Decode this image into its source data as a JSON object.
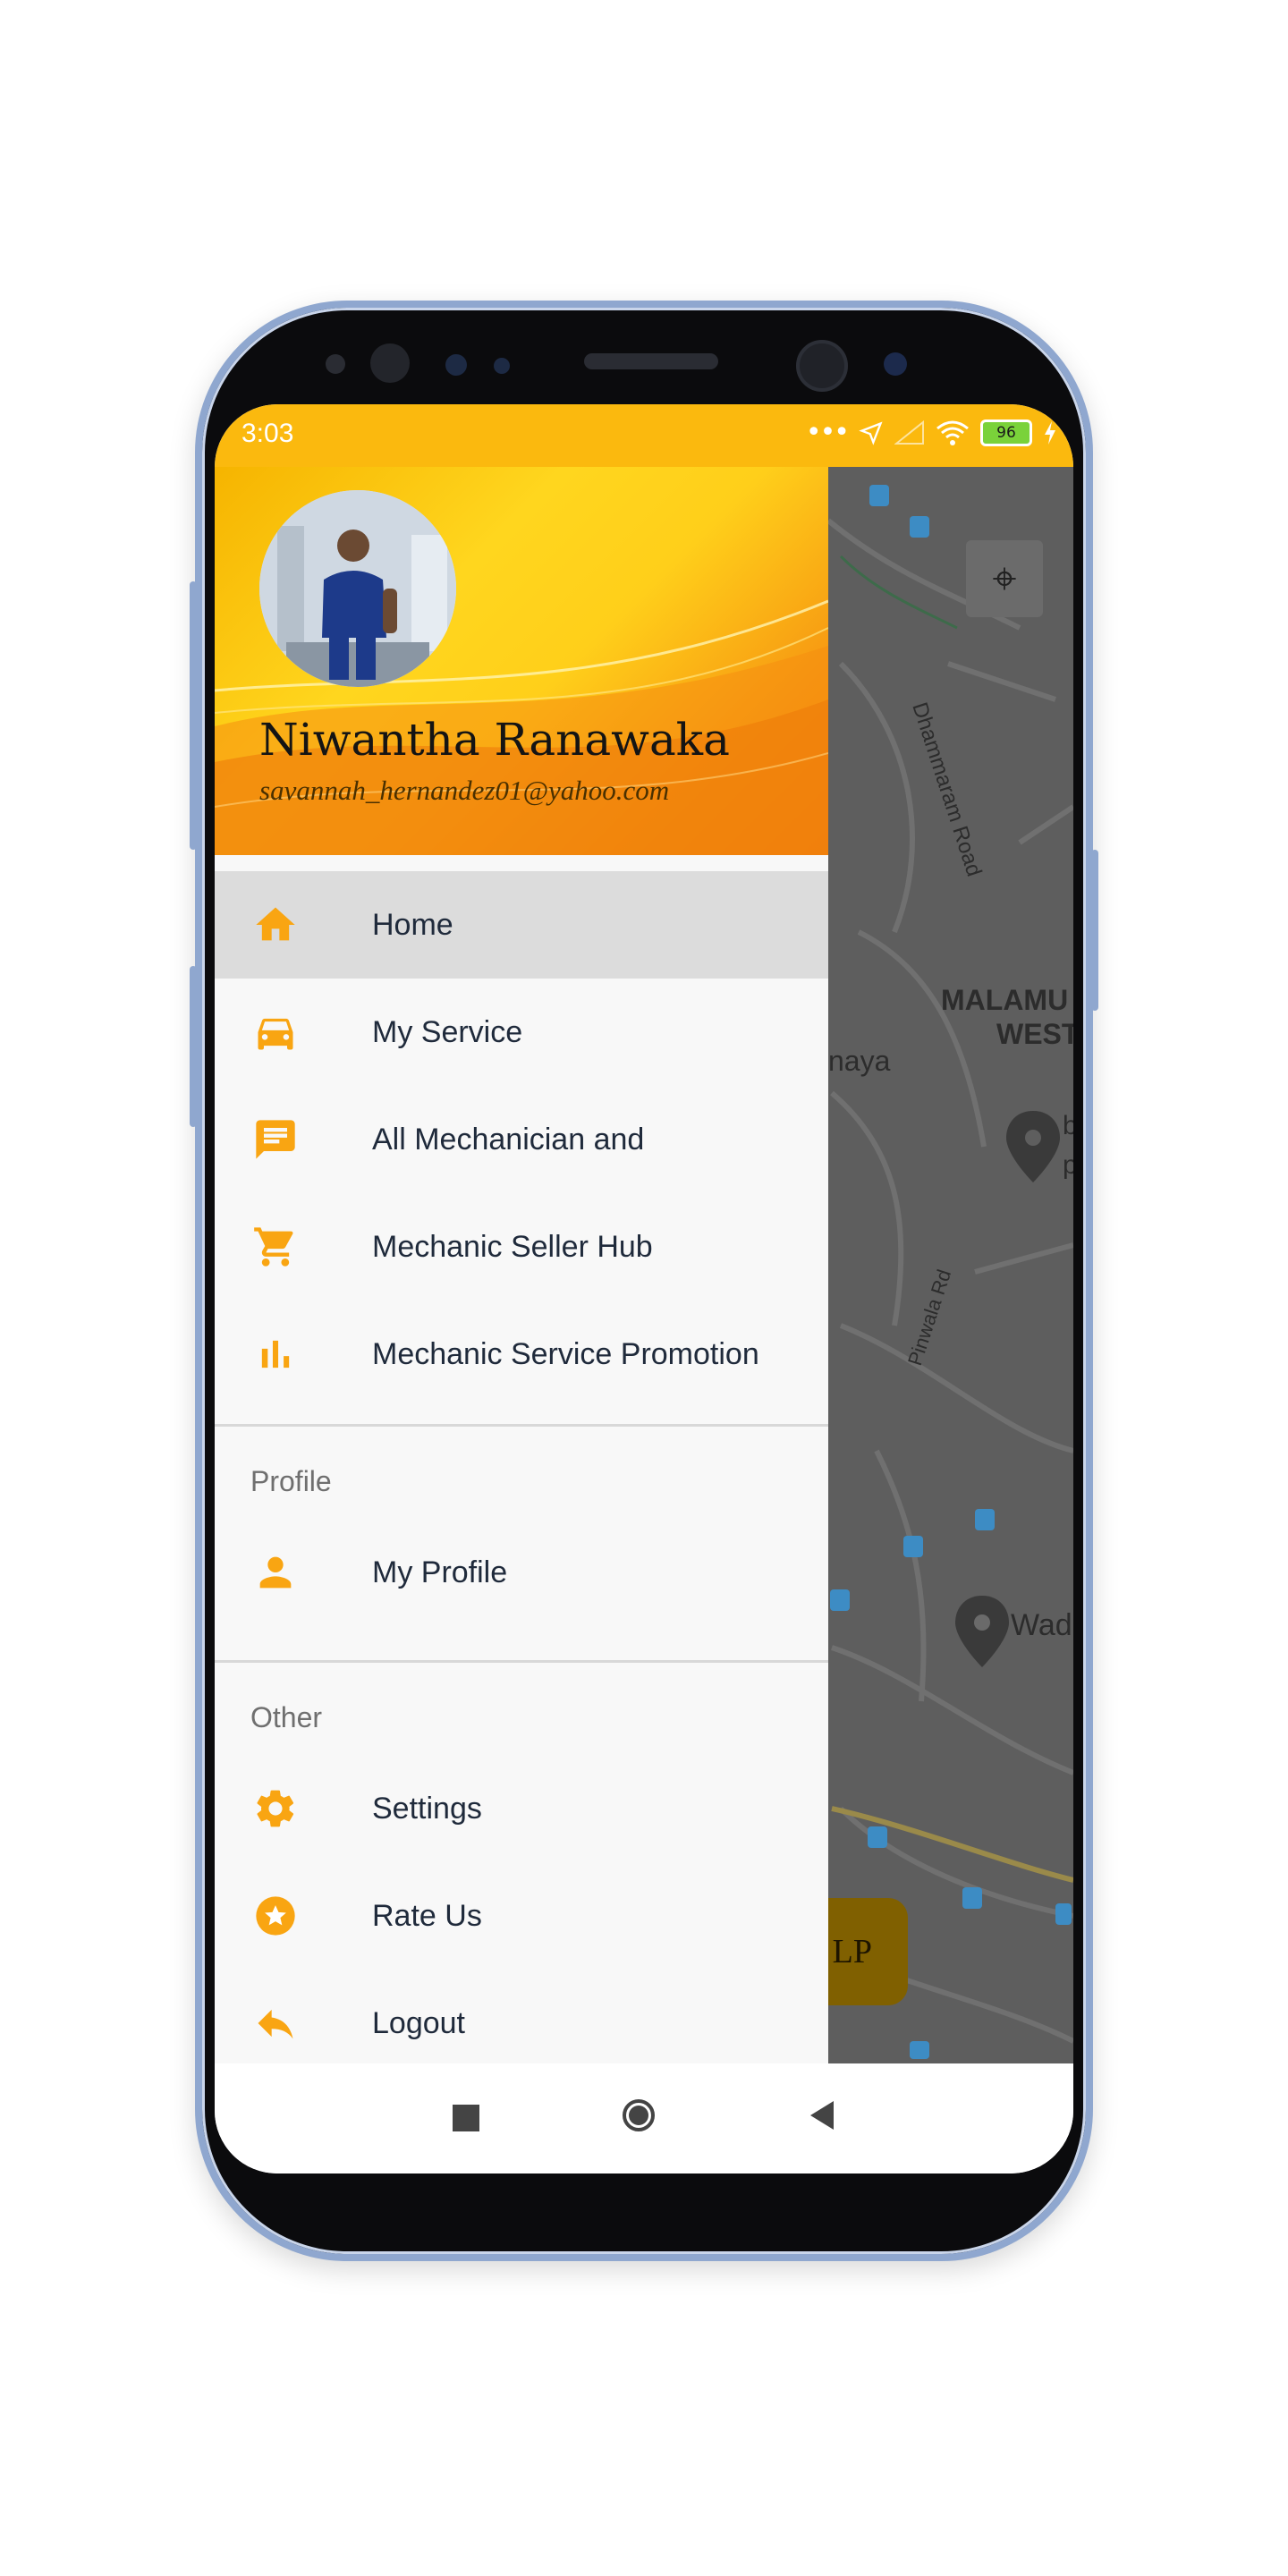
{
  "status_bar": {
    "time": "3:03",
    "battery_level": "96",
    "icons": [
      "dots-icon",
      "location-arrow-icon",
      "signal-icon",
      "wifi-icon",
      "battery-icon",
      "charging-icon"
    ]
  },
  "drawer": {
    "header": {
      "name": "Niwantha Ranawaka",
      "email": "savannah_hernandez01@yahoo.com"
    },
    "items": [
      {
        "label": "Home",
        "icon": "home-icon",
        "active": true
      },
      {
        "label": "My Service",
        "icon": "car-icon"
      },
      {
        "label": "All Mechanician and",
        "icon": "chat-icon"
      },
      {
        "label": "Mechanic Seller Hub",
        "icon": "cart-icon"
      },
      {
        "label": "Mechanic Service Promotion",
        "icon": "bar-chart-icon"
      }
    ],
    "profile_section": {
      "title": "Profile",
      "items": [
        {
          "label": "My Profile",
          "icon": "person-icon"
        }
      ]
    },
    "other_section": {
      "title": "Other",
      "items": [
        {
          "label": "Settings",
          "icon": "gear-icon"
        },
        {
          "label": "Rate Us",
          "icon": "star-icon"
        },
        {
          "label": "Logout",
          "icon": "reply-icon"
        }
      ]
    }
  },
  "map": {
    "labels": {
      "road1": "Dhammaram Road",
      "area": "MALAMU",
      "area2": "WEST",
      "place": "naya",
      "road2": "Pinwala Rd",
      "place2": "Wad",
      "pin_text": "b",
      "pin_text2": "p"
    },
    "help_button": "LP"
  },
  "nav_bar": {
    "icons": [
      "recent-apps-icon",
      "home-circle-icon",
      "back-icon"
    ]
  },
  "colors": {
    "accent": "#fbb90e",
    "icon": "#f9a512",
    "text": "#1f2a3b"
  }
}
